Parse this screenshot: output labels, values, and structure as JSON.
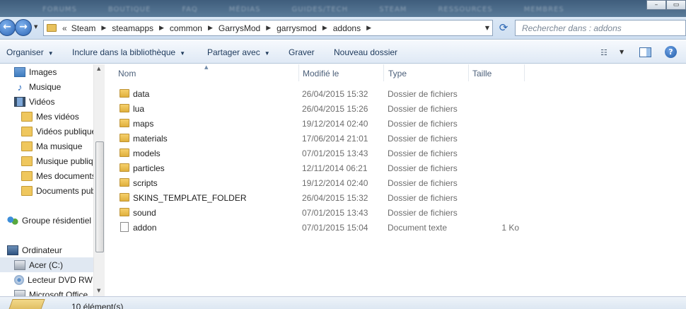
{
  "background_menu": [
    "FORUMS",
    "BOUTIQUE",
    "FAQ",
    "MÉDIAS",
    "GUIDES/TECH",
    "STEAM",
    "RESSOURCES",
    "MEMBRES"
  ],
  "address": {
    "lead": "«",
    "crumbs": [
      "Steam",
      "steamapps",
      "common",
      "GarrysMod",
      "garrysmod",
      "addons"
    ]
  },
  "search": {
    "placeholder": "Rechercher dans : addons"
  },
  "toolbar": {
    "organise": "Organiser",
    "include": "Inclure dans la bibliothèque",
    "share": "Partager avec",
    "burn": "Graver",
    "new_folder": "Nouveau dossier"
  },
  "sidebar": {
    "items": [
      {
        "label": "Images",
        "icon": "images-icon"
      },
      {
        "label": "Musique",
        "icon": "music-icon"
      },
      {
        "label": "Vidéos",
        "icon": "videos-icon"
      },
      {
        "label": "Mes vidéos",
        "icon": "folder-icon"
      },
      {
        "label": "Vidéos publiques",
        "icon": "folder-icon"
      },
      {
        "label": "Ma musique",
        "icon": "folder-icon"
      },
      {
        "label": "Musique publique",
        "icon": "folder-icon"
      },
      {
        "label": "Mes documents",
        "icon": "folder-icon"
      },
      {
        "label": "Documents publics",
        "icon": "folder-icon"
      },
      {
        "label": "Groupe résidentiel",
        "icon": "homegroup-icon"
      },
      {
        "label": "Ordinateur",
        "icon": "computer-icon"
      },
      {
        "label": "Acer (C:)",
        "icon": "drive-icon"
      },
      {
        "label": "Lecteur DVD RW",
        "icon": "dvd-icon"
      },
      {
        "label": "Microsoft Office",
        "icon": "drive-icon"
      }
    ]
  },
  "columns": {
    "name": "Nom",
    "modified": "Modifié le",
    "type": "Type",
    "size": "Taille"
  },
  "files": [
    {
      "name": "data",
      "date": "26/04/2015 15:32",
      "type": "Dossier de fichiers",
      "size": "",
      "kind": "folder"
    },
    {
      "name": "lua",
      "date": "26/04/2015 15:26",
      "type": "Dossier de fichiers",
      "size": "",
      "kind": "folder"
    },
    {
      "name": "maps",
      "date": "19/12/2014 02:40",
      "type": "Dossier de fichiers",
      "size": "",
      "kind": "folder"
    },
    {
      "name": "materials",
      "date": "17/06/2014 21:01",
      "type": "Dossier de fichiers",
      "size": "",
      "kind": "folder"
    },
    {
      "name": "models",
      "date": "07/01/2015 13:43",
      "type": "Dossier de fichiers",
      "size": "",
      "kind": "folder"
    },
    {
      "name": "particles",
      "date": "12/11/2014 06:21",
      "type": "Dossier de fichiers",
      "size": "",
      "kind": "folder"
    },
    {
      "name": "scripts",
      "date": "19/12/2014 02:40",
      "type": "Dossier de fichiers",
      "size": "",
      "kind": "folder"
    },
    {
      "name": "SKINS_TEMPLATE_FOLDER",
      "date": "26/04/2015 15:32",
      "type": "Dossier de fichiers",
      "size": "",
      "kind": "folder"
    },
    {
      "name": "sound",
      "date": "07/01/2015 13:43",
      "type": "Dossier de fichiers",
      "size": "",
      "kind": "folder"
    },
    {
      "name": "addon",
      "date": "07/01/2015 15:04",
      "type": "Document texte",
      "size": "1 Ko",
      "kind": "doc"
    }
  ],
  "status": {
    "count": "10 élément(s)"
  }
}
